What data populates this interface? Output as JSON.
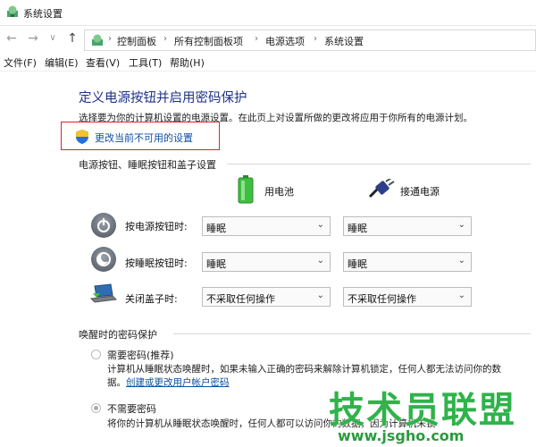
{
  "window": {
    "title": "系统设置",
    "icon": "control-panel-icon"
  },
  "nav": {
    "back": "←",
    "forward": "→",
    "recent": "∨",
    "up": "↑"
  },
  "breadcrumb": [
    "控制面板",
    "所有控制面板项",
    "电源选项",
    "系统设置"
  ],
  "menu": [
    "文件(F)",
    "编辑(E)",
    "查看(V)",
    "工具(T)",
    "帮助(H)"
  ],
  "page": {
    "title": "定义电源按钮并启用密码保护",
    "description": "选择要为你的计算机设置的电源设置。在此页上对设置所做的更改将应用于你所有的电源计划。",
    "change_link": "更改当前不可用的设置"
  },
  "power_section": {
    "heading": "电源按钮、睡眠按钮和盖子设置",
    "col_battery": "用电池",
    "col_plugged": "接通电源",
    "rows": [
      {
        "label": "按电源按钮时:",
        "battery": "睡眠",
        "plugged": "睡眠",
        "icon": "power-button-icon"
      },
      {
        "label": "按睡眠按钮时:",
        "battery": "睡眠",
        "plugged": "睡眠",
        "icon": "sleep-button-icon"
      },
      {
        "label": "关闭盖子时:",
        "battery": "不采取任何操作",
        "plugged": "不采取任何操作",
        "icon": "laptop-lid-icon"
      }
    ]
  },
  "password_section": {
    "heading": "唤醒时的密码保护",
    "require": {
      "label": "需要密码(推荐)",
      "text_line1": "计算机从睡眠状态唤醒时，如果未输入正确的密码来解除计算机锁定，任何人都无法访问你的数",
      "text_line2_prefix": "据。",
      "link": "创建或更改用户帐户密码"
    },
    "no_require": {
      "label": "不需要密码",
      "text_line1": "将你的计算机从睡眠状态唤醒时，任何人都可以访问你的数据，因为计算机未锁"
    }
  },
  "watermark": {
    "brand": "技术员联盟",
    "url": "www.jsgho.com"
  },
  "colors": {
    "title_blue": "#1e3287",
    "link_blue": "#0f4fa0",
    "highlight_red": "#d9262c",
    "watermark_green": "#2fb34a"
  }
}
